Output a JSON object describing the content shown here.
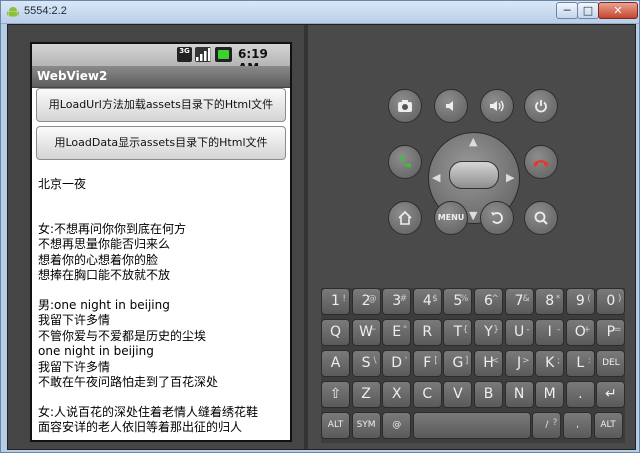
{
  "window": {
    "title": "5554:2.2",
    "buttons": {
      "min": "─",
      "max": "□",
      "close": "✕"
    }
  },
  "status_bar": {
    "network": "3G",
    "time": "6:19 AM"
  },
  "app": {
    "title": "WebView2"
  },
  "buttons": [
    {
      "label": "用LoadUrl方法加载assets目录下的Html文件"
    },
    {
      "label": "用LoadData显示assets目录下的Html文件"
    }
  ],
  "content": {
    "heading": "北京一夜",
    "stanzas": [
      [
        "女:不想再问你你到底在何方",
        "不想再思量你能否归来么",
        "想着你的心想着你的脸",
        "想捧在胸口能不放就不放"
      ],
      [
        "男:one night in beijing",
        "我留下许多情",
        "不管你爱与不爱都是历史的尘埃",
        "one night in beijing",
        "我留下许多情",
        "不敢在午夜问路怕走到了百花深处"
      ],
      [
        "女:人说百花的深处住着老情人缝着绣花鞋",
        "面容安详的老人依旧等着那出征的归人"
      ]
    ]
  },
  "controls": {
    "row1": [
      "camera-icon",
      "volume-down-icon",
      "volume-up-icon",
      "power-icon"
    ],
    "row2": [
      "call-icon",
      "dpad",
      "end-call-icon"
    ],
    "row3": [
      "home-icon",
      "MENU",
      "back-icon",
      "search-icon"
    ]
  },
  "keyboard": {
    "row1": [
      [
        "1",
        "!"
      ],
      [
        "2",
        "@"
      ],
      [
        "3",
        "#"
      ],
      [
        "4",
        "$"
      ],
      [
        "5",
        "%"
      ],
      [
        "6",
        "^"
      ],
      [
        "7",
        "&"
      ],
      [
        "8",
        "*"
      ],
      [
        "9",
        "("
      ],
      [
        "0",
        ")"
      ]
    ],
    "row2": [
      [
        "Q",
        ""
      ],
      [
        "W",
        "~"
      ],
      [
        "E",
        "\""
      ],
      [
        "R",
        ""
      ],
      [
        "T",
        "{"
      ],
      [
        "Y",
        "}"
      ],
      [
        "U",
        "-"
      ],
      [
        "I",
        "-"
      ],
      [
        "O",
        "+"
      ],
      [
        "P",
        "="
      ]
    ],
    "row3": [
      [
        "A",
        ""
      ],
      [
        "S",
        "\\"
      ],
      [
        "D",
        "'"
      ],
      [
        "F",
        "["
      ],
      [
        "G",
        "]"
      ],
      [
        "H",
        "<"
      ],
      [
        "J",
        ">"
      ],
      [
        "K",
        ";"
      ],
      [
        "L",
        ":"
      ],
      [
        "DEL",
        ""
      ]
    ],
    "row4": [
      [
        "⇧",
        ""
      ],
      [
        "Z",
        ""
      ],
      [
        "X",
        ""
      ],
      [
        "C",
        ""
      ],
      [
        "V",
        ""
      ],
      [
        "B",
        ""
      ],
      [
        "N",
        ""
      ],
      [
        "M",
        ""
      ],
      [
        ".",
        ""
      ],
      [
        "↵",
        ""
      ]
    ],
    "row5": [
      [
        "ALT",
        ""
      ],
      [
        "SYM",
        ""
      ],
      [
        "@",
        ""
      ],
      [
        "",
        ""
      ],
      [
        "/",
        "?"
      ],
      [
        ",",
        ""
      ],
      [
        "ALT",
        ""
      ]
    ]
  }
}
